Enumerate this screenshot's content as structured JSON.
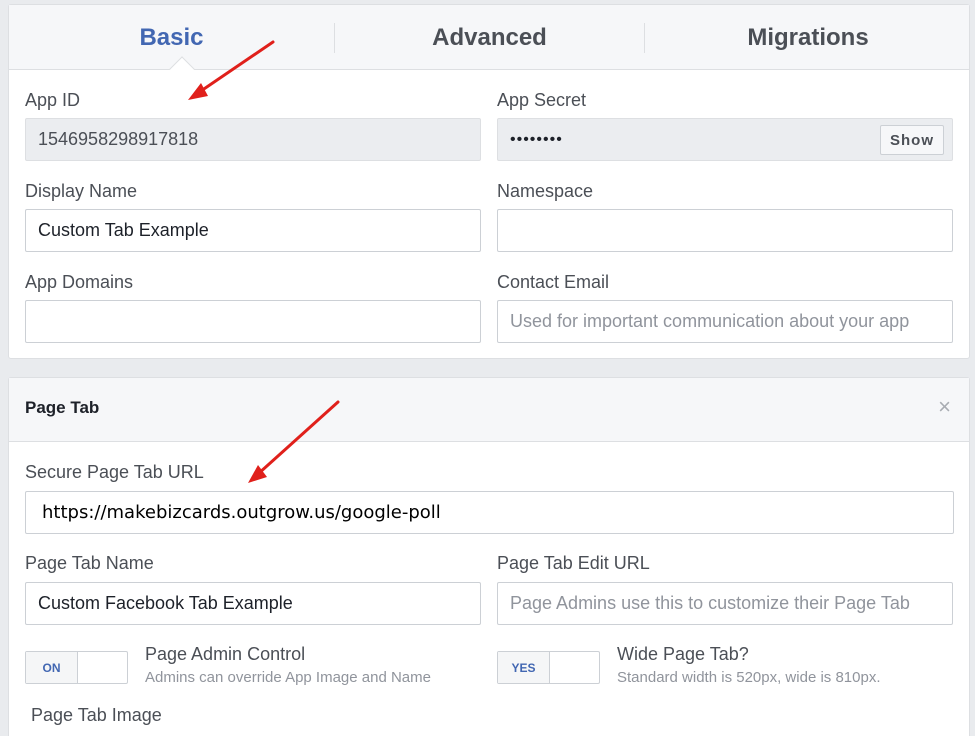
{
  "tabs": {
    "basic": "Basic",
    "advanced": "Advanced",
    "migrations": "Migrations"
  },
  "basic_settings": {
    "app_id_label": "App ID",
    "app_id_value": "1546958298917818",
    "app_secret_label": "App Secret",
    "app_secret_value": "••••••••",
    "show_button": "Show",
    "display_name_label": "Display Name",
    "display_name_value": "Custom Tab Example",
    "namespace_label": "Namespace",
    "namespace_value": "",
    "app_domains_label": "App Domains",
    "app_domains_value": "",
    "contact_email_label": "Contact Email",
    "contact_email_placeholder": "Used for important communication about your app"
  },
  "page_tab": {
    "title": "Page Tab",
    "close_icon": "×",
    "secure_url_label": "Secure Page Tab URL",
    "secure_url_value": "https://makebizcards.outgrow.us/google-poll",
    "name_label": "Page Tab Name",
    "name_value": "Custom Facebook Tab Example",
    "edit_url_label": "Page Tab Edit URL",
    "edit_url_placeholder": "Page Admins use this to customize their Page Tab",
    "admin_control": {
      "toggle_state": "ON",
      "title": "Page Admin Control",
      "description": "Admins can override App Image and Name"
    },
    "wide_tab": {
      "toggle_state": "YES",
      "title": "Wide Page Tab?",
      "description": "Standard width is 520px, wide is 810px."
    },
    "image_label": "Page Tab Image"
  },
  "colors": {
    "accent": "#4267b2",
    "annotation_arrow": "#e0201b"
  }
}
